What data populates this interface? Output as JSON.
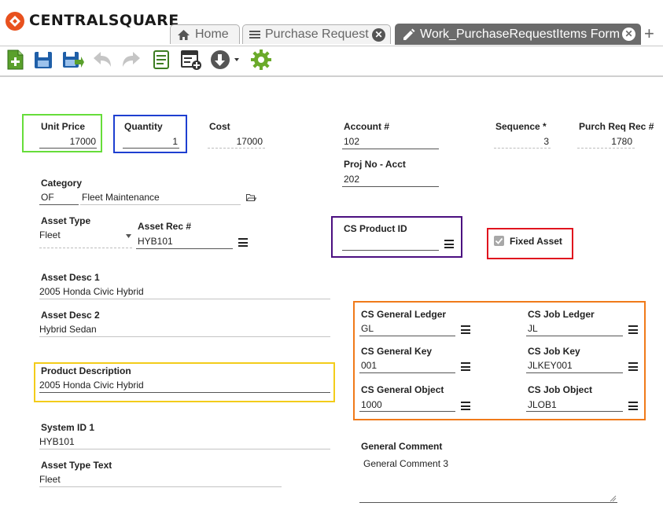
{
  "app": {
    "logo_text": "CENTRALSQUARE"
  },
  "tabs": [
    {
      "label": "Home",
      "icon": "home-icon",
      "closable": false,
      "active": false
    },
    {
      "label": "Purchase Request",
      "icon": "list-icon",
      "closable": true,
      "active": false
    },
    {
      "label": "Work_PurchaseRequestItems Form",
      "icon": "pencil-icon",
      "closable": true,
      "active": true
    }
  ],
  "tab_close_glyph": "✕",
  "new_tab_glyph": "+",
  "toolbar": {
    "icons": [
      "add-record-icon",
      "save-icon",
      "save-and-close-icon",
      "undo-icon",
      "redo-icon",
      "script-icon",
      "form-settings-icon",
      "navigate-icon",
      "settings-gear-icon"
    ],
    "colors": {
      "green": "#5aa02c",
      "blue": "#1f5fa8",
      "gray": "#c5c5c5",
      "dark": "#333333"
    }
  },
  "highlight_colors": {
    "green": "#66dd3a",
    "blue": "#1e3fd0",
    "purple": "#4b0f80",
    "red": "#e0141e",
    "orange": "#f07a1a",
    "yellow": "#f3cc1a"
  },
  "form": {
    "unit_price": {
      "label": "Unit Price",
      "value": "17000"
    },
    "quantity": {
      "label": "Quantity",
      "value": "1"
    },
    "cost": {
      "label": "Cost",
      "value": "17000"
    },
    "account": {
      "label": "Account #",
      "value": "102"
    },
    "sequence": {
      "label": "Sequence *",
      "value": "3"
    },
    "purch_req_rec": {
      "label": "Purch Req Rec #",
      "value": "1780"
    },
    "proj_no_acct": {
      "label": "Proj No - Acct",
      "value": "202"
    },
    "category": {
      "label": "Category",
      "code": "OF",
      "description": "Fleet Maintenance"
    },
    "asset_type": {
      "label": "Asset Type",
      "value": "Fleet"
    },
    "asset_rec": {
      "label": "Asset Rec #",
      "value": "HYB101"
    },
    "cs_product_id": {
      "label": "CS Product ID",
      "value": ""
    },
    "fixed_asset": {
      "label": "Fixed Asset",
      "checked": true
    },
    "asset_desc_1": {
      "label": "Asset Desc 1",
      "value": "2005 Honda Civic Hybrid"
    },
    "asset_desc_2": {
      "label": "Asset Desc 2",
      "value": "Hybrid Sedan"
    },
    "cs_general_ledger": {
      "label": "CS General Ledger",
      "value": "GL"
    },
    "cs_job_ledger": {
      "label": "CS Job Ledger",
      "value": "JL"
    },
    "cs_general_key": {
      "label": "CS General Key",
      "value": "001"
    },
    "cs_job_key": {
      "label": "CS Job Key",
      "value": "JLKEY001"
    },
    "cs_general_object": {
      "label": "CS General Object",
      "value": "1000"
    },
    "cs_job_object": {
      "label": "CS Job Object",
      "value": "JLOB1"
    },
    "product_description": {
      "label": "Product Description",
      "value": "2005 Honda Civic Hybrid"
    },
    "system_id_1": {
      "label": "System ID 1",
      "value": "HYB101"
    },
    "asset_type_text": {
      "label": "Asset Type Text",
      "value": "Fleet"
    },
    "general_comment": {
      "label": "General Comment",
      "value": "General Comment 3"
    }
  }
}
